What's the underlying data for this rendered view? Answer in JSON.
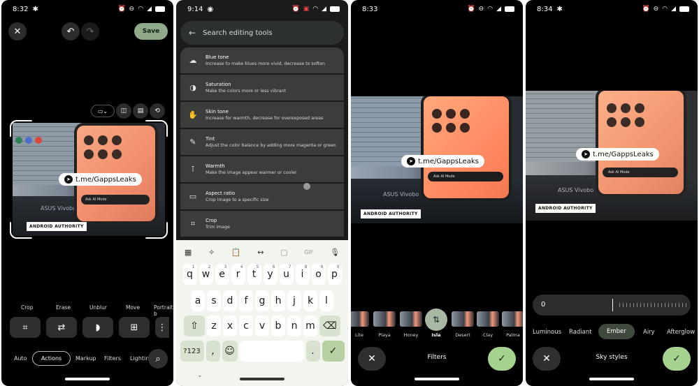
{
  "panel1": {
    "status": {
      "time": "8:32",
      "battery": "88"
    },
    "header": {
      "save_label": "Save"
    },
    "photo": {
      "watermark": "t.me/GappsLeaks",
      "laptop_label": "ASUS Vivobo",
      "badge": "ANDROID AUTHORITY"
    },
    "tools": {
      "labels": [
        "Crop",
        "Erase",
        "Unblur",
        "Move",
        "Portrait b"
      ],
      "icons": [
        "crop-icon",
        "erase-icon",
        "unblur-icon",
        "move-icon",
        "portrait-icon"
      ]
    },
    "tabs": [
      "Auto",
      "Actions",
      "Markup",
      "Filters",
      "Lighting"
    ],
    "active_tab": "Actions"
  },
  "panel2": {
    "status": {
      "time": "9:14"
    },
    "search_placeholder": "Search editing tools",
    "tools": [
      {
        "title": "Blue tone",
        "desc": "Increase to make blues more vivid, decrease to soften",
        "icon": "cloud-icon"
      },
      {
        "title": "Saturation",
        "desc": "Make the colors more or less vibrant",
        "icon": "contrast-icon"
      },
      {
        "title": "Skin tone",
        "desc": "Increase for warmth, decrease for overexposed areas",
        "icon": "hand-icon"
      },
      {
        "title": "Tint",
        "desc": "Adjust the color balance by adding more magenta or green",
        "icon": "eyedropper-icon"
      },
      {
        "title": "Warmth",
        "desc": "Make the image appear warmer or cooler",
        "icon": "thermometer-icon"
      },
      {
        "title": "Aspect ratio",
        "desc": "Crop image to a specific size",
        "icon": "aspect-ratio-icon"
      },
      {
        "title": "Crop",
        "desc": "Trim image",
        "icon": "crop-icon"
      }
    ],
    "keyboard": {
      "row1": [
        "q",
        "w",
        "e",
        "r",
        "t",
        "y",
        "u",
        "i",
        "o",
        "p"
      ],
      "row1_nums": [
        "1",
        "2",
        "3",
        "4",
        "5",
        "6",
        "7",
        "8",
        "9",
        "0"
      ],
      "row2": [
        "a",
        "s",
        "d",
        "f",
        "g",
        "h",
        "j",
        "k",
        "l"
      ],
      "row3": [
        "z",
        "x",
        "c",
        "v",
        "b",
        "n",
        "m"
      ],
      "symbols_key": "?123",
      "comma": ",",
      "period": ".",
      "gif": "GIF"
    }
  },
  "panel3": {
    "status": {
      "time": "8:33"
    },
    "photo": {
      "watermark": "t.me/GappsLeaks",
      "laptop_label": "ASUS Vivobo",
      "badge": "ANDROID AUTHORITY",
      "search": "Ask AI Mode"
    },
    "filters": [
      "Lite",
      "Playa",
      "Honey",
      "Isla",
      "Desert",
      "Clay",
      "Palma"
    ],
    "selected_filter": "Isla",
    "footer_title": "Filters"
  },
  "panel4": {
    "status": {
      "time": "8:34"
    },
    "photo": {
      "watermark": "t.me/GappsLeaks",
      "laptop_label": "ASUS Vivobo",
      "badge": "ANDROID AUTHORITY",
      "search": "Ask AI Mode"
    },
    "slider_value": "0",
    "styles": [
      "Luminous",
      "Radiant",
      "Ember",
      "Airy",
      "Afterglow"
    ],
    "selected_style": "Ember",
    "footer_title": "Sky styles"
  },
  "photo1": {
    "search": "Ask AI Mode"
  },
  "colors": {
    "accent_green": "#a6d28f",
    "chip_selected": "#3f4a3c",
    "panel_surface": "#3a3d39"
  }
}
